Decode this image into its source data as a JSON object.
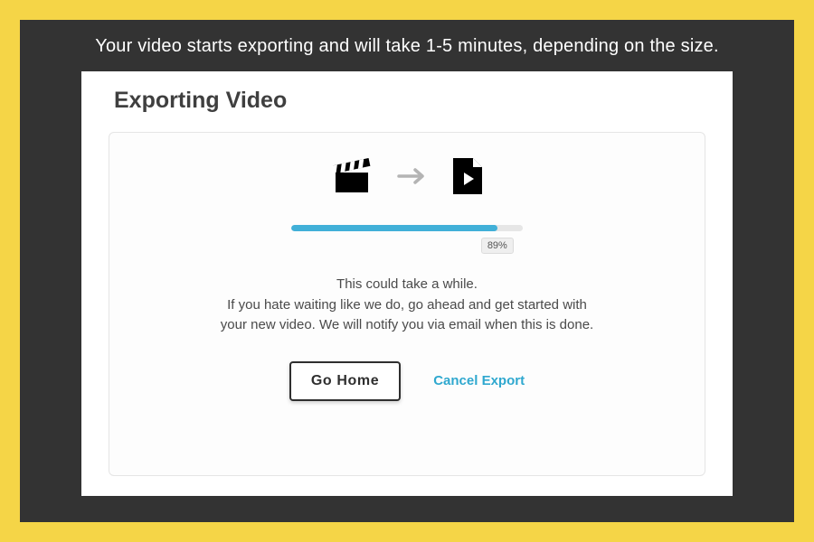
{
  "caption": "Your video starts exporting and will take 1-5 minutes, depending on the size.",
  "dialog": {
    "title": "Exporting Video",
    "progress": {
      "percent": 89,
      "label": "89%"
    },
    "message": {
      "line1": "This could take a while.",
      "line2": "If you hate waiting like we do, go ahead and get started with",
      "line3": "your new video. We will notify you via email when this is done."
    },
    "buttons": {
      "go_home": "Go Home",
      "cancel": "Cancel Export"
    }
  },
  "colors": {
    "accent": "#41b0d8",
    "frame_bg": "#333333",
    "outer_bg": "#f5d547"
  }
}
